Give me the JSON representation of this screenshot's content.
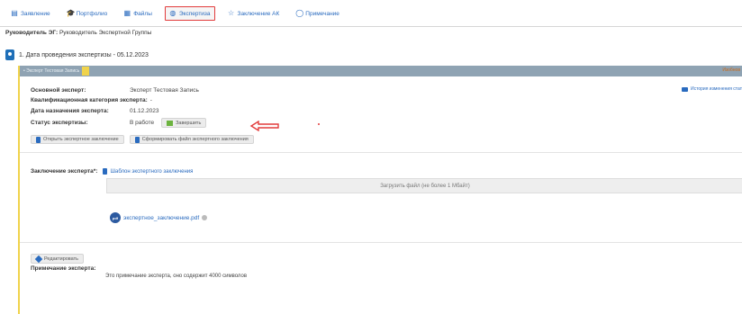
{
  "tabs": [
    {
      "label": "Заявление",
      "icon": "document-icon"
    },
    {
      "label": "Портфолио",
      "icon": "graduation-cap-icon"
    },
    {
      "label": "Файлы",
      "icon": "files-icon"
    },
    {
      "label": "Экспертиза",
      "icon": "globe-icon",
      "active": true
    },
    {
      "label": "Заключение АК",
      "icon": "star-icon"
    },
    {
      "label": "Примечание",
      "icon": "comment-icon"
    }
  ],
  "leader": {
    "label": "Руководитель ЭГ:",
    "value": "Руководитель Экспертной Группы"
  },
  "section": {
    "title": "1. Дата проведения экспертизы - 05.12.2023"
  },
  "card": {
    "header_label": "• Эксперт Тестовая Запись",
    "header_right": "Изобнов",
    "history_link": "История изменения стат"
  },
  "fields": [
    {
      "label": "Основной эксперт:",
      "value": "Эксперт Тестовая Запись"
    },
    {
      "label": "Квалификационная категория эксперта:",
      "value": "-"
    },
    {
      "label": "Дата назначения эксперта:",
      "value": "01.12.2023"
    },
    {
      "label": "Статус экспертизы:",
      "value": "В работе"
    }
  ],
  "buttons": {
    "finish": "Завершить",
    "open_conclusion": "Открыть экспертное заключение",
    "generate_file": "Сформировать файл экспертного заключения",
    "edit": "Редактировать"
  },
  "conclusion": {
    "label": "Заключение эксперта*:",
    "template_link": "Шаблон экспертного заключения",
    "upload_label": "Загрузить файл (не более 1 Мбайт)",
    "file_name": "экспертное_заключение.pdf",
    "file_type": "pdf"
  },
  "note": {
    "label": "Примечание эксперта:",
    "text": "Это примечание эксперта, оно содержит 4000 символов"
  },
  "colors": {
    "accent": "#2a6bbf",
    "active_tab_border": "#e23b3b",
    "card_header": "#8fa3b3",
    "card_stripe": "#f0d34c",
    "status_flag": "#6cb33f"
  }
}
